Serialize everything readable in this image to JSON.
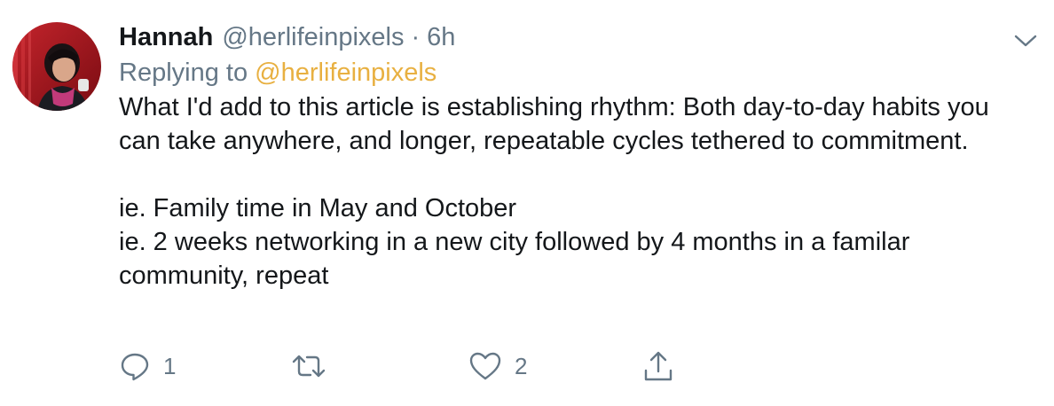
{
  "tweet": {
    "name": "Hannah",
    "handle": "@herlifeinpixels",
    "separator": "·",
    "time": "6h",
    "replying_prefix": "Replying to",
    "replying_handle": "@herlifeinpixels",
    "paragraphs": [
      "What I'd add to this article is establishing rhythm: Both day-to-day habits you can take anywhere, and longer, repeatable cycles tethered to commitment.",
      "ie. Family time in May and October\nie. 2 weeks networking in a new city followed by 4 months in a familar community, repeat"
    ],
    "actions": {
      "reply_count": "1",
      "retweet_count": "",
      "like_count": "2"
    }
  },
  "icons": {
    "caret": "chevron-down-icon",
    "reply": "reply-bubble-icon",
    "retweet": "retweet-icon",
    "like": "heart-icon",
    "share": "share-icon"
  },
  "colors": {
    "text": "#14171a",
    "secondary": "#657786",
    "mention_link": "#e8b041",
    "avatar_background": "#a8141c"
  }
}
